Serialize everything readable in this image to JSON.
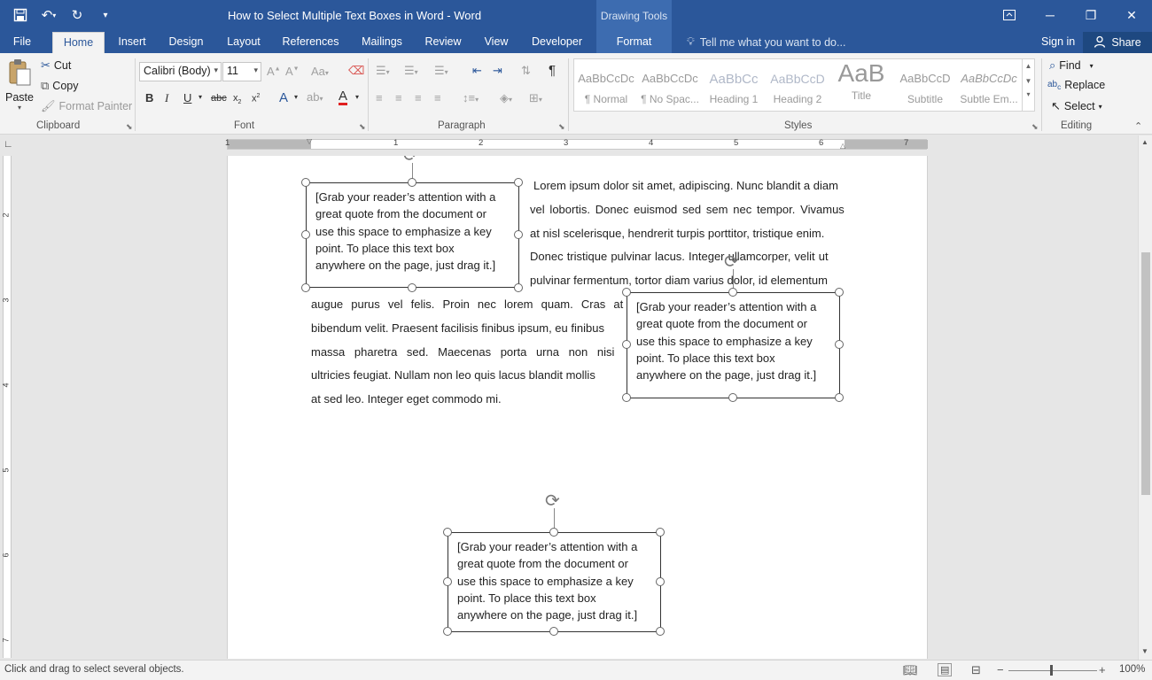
{
  "window": {
    "title": "How to Select Multiple Text Boxes in Word - Word",
    "contextual_tab_group": "Drawing Tools"
  },
  "ribbon_tabs": [
    "File",
    "Home",
    "Insert",
    "Design",
    "Layout",
    "References",
    "Mailings",
    "Review",
    "View",
    "Developer",
    "Format"
  ],
  "active_tab": "Home",
  "tell_me": "Tell me what you want to do...",
  "account": {
    "sign_in": "Sign in",
    "share": "Share"
  },
  "clipboard": {
    "paste": "Paste",
    "cut": "Cut",
    "copy": "Copy",
    "format_painter": "Format Painter",
    "label": "Clipboard"
  },
  "font": {
    "name": "Calibri (Body)",
    "size": "11",
    "label": "Font"
  },
  "paragraph": {
    "label": "Paragraph"
  },
  "styles": {
    "label": "Styles",
    "items": [
      {
        "preview": "AaBbCcDc",
        "name": "¶ Normal"
      },
      {
        "preview": "AaBbCcDc",
        "name": "¶ No Spac..."
      },
      {
        "preview": "AaBbCc",
        "name": "Heading 1"
      },
      {
        "preview": "AaBbCcD",
        "name": "Heading 2"
      },
      {
        "preview": "AaB",
        "name": "Title"
      },
      {
        "preview": "AaBbCcD",
        "name": "Subtitle"
      },
      {
        "preview": "AaBbCcDc",
        "name": "Subtle Em..."
      }
    ]
  },
  "editing": {
    "find": "Find",
    "replace": "Replace",
    "select": "Select",
    "label": "Editing"
  },
  "ruler": {
    "h_numbers": [
      "1",
      "1",
      "2",
      "3",
      "4",
      "5",
      "6",
      "7"
    ],
    "v_numbers": [
      "2",
      "3",
      "4",
      "5",
      "6",
      "7"
    ]
  },
  "document": {
    "paragraph_lines": [
      "Lorem ipsum dolor sit amet, adipiscing. Nunc blandit a diam",
      "vel lobortis. Donec euismod sed sem nec tempor. Vivamus",
      "at nisl scelerisque, hendrerit turpis porttitor, tristique enim.",
      "Donec tristique pulvinar lacus. Integer ullamcorper, velit ut",
      "pulvinar fermentum, tortor diam varius dolor, id elementum",
      "augue purus vel felis. Proin nec lorem quam. Cras at",
      "bibendum velit. Praesent facilisis finibus ipsum, eu finibus",
      "massa pharetra sed. Maecenas porta urna non nisi",
      "ultricies feugiat. Nullam non leo quis lacus blandit mollis",
      "at sed leo. Integer eget commodo mi."
    ],
    "text_boxes": [
      {
        "lines": [
          "[Grab your reader’s attention with a",
          "great quote from the document or",
          "use this space to emphasize a key",
          "point. To place this text box",
          "anywhere on the page, just drag it.]"
        ]
      },
      {
        "lines": [
          "[Grab your reader’s attention with a",
          "great quote from the document or",
          "use this space to emphasize a key",
          "point. To place this text box",
          "anywhere on the page, just drag it.]"
        ]
      },
      {
        "lines": [
          "[Grab your reader’s attention with a",
          "great quote from the document or",
          "use this space to emphasize a key",
          "point. To place this text box",
          "anywhere on the page, just drag it.]"
        ]
      }
    ]
  },
  "status": {
    "message": "Click and drag to select several objects.",
    "zoom": "100%"
  }
}
